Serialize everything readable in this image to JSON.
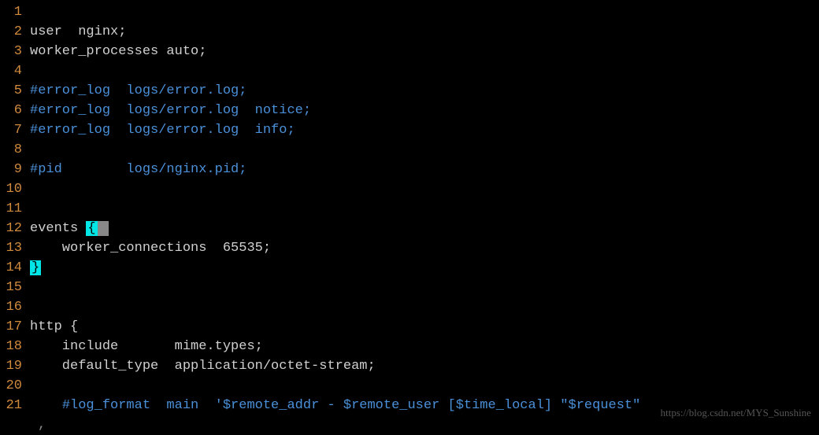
{
  "lines": [
    {
      "num": "1",
      "segments": []
    },
    {
      "num": "2",
      "segments": [
        {
          "cls": "plain",
          "text": "user  nginx;"
        }
      ]
    },
    {
      "num": "3",
      "segments": [
        {
          "cls": "plain",
          "text": "worker_processes auto;"
        }
      ]
    },
    {
      "num": "4",
      "segments": []
    },
    {
      "num": "5",
      "segments": [
        {
          "cls": "comment",
          "text": "#error_log  logs/error.log;"
        }
      ]
    },
    {
      "num": "6",
      "segments": [
        {
          "cls": "comment",
          "text": "#error_log  logs/error.log  notice;"
        }
      ]
    },
    {
      "num": "7",
      "segments": [
        {
          "cls": "comment",
          "text": "#error_log  logs/error.log  info;"
        }
      ]
    },
    {
      "num": "8",
      "segments": []
    },
    {
      "num": "9",
      "segments": [
        {
          "cls": "comment",
          "text": "#pid        logs/nginx.pid;"
        }
      ]
    },
    {
      "num": "10",
      "segments": []
    },
    {
      "num": "11",
      "segments": []
    },
    {
      "num": "12",
      "segments": [
        {
          "cls": "plain",
          "text": "events "
        },
        {
          "cls": "brace",
          "text": "{"
        },
        {
          "cls": "brace-dim",
          "text": " "
        }
      ]
    },
    {
      "num": "13",
      "segments": [
        {
          "cls": "plain",
          "text": "    worker_connections  65535;"
        }
      ]
    },
    {
      "num": "14",
      "segments": [
        {
          "cls": "brace",
          "text": "}"
        }
      ]
    },
    {
      "num": "15",
      "segments": []
    },
    {
      "num": "16",
      "segments": []
    },
    {
      "num": "17",
      "segments": [
        {
          "cls": "plain",
          "text": "http {"
        }
      ]
    },
    {
      "num": "18",
      "segments": [
        {
          "cls": "plain",
          "text": "    include       mime.types;"
        }
      ]
    },
    {
      "num": "19",
      "segments": [
        {
          "cls": "plain",
          "text": "    default_type  application/octet-stream;"
        }
      ]
    },
    {
      "num": "20",
      "segments": []
    },
    {
      "num": "21",
      "segments": [
        {
          "cls": "plain",
          "text": "    "
        },
        {
          "cls": "comment",
          "text": "#log_format  main  '$remote_addr - $remote_user [$time_local] \"$request\""
        }
      ]
    }
  ],
  "continuation": ",",
  "watermark": "https://blog.csdn.net/MYS_Sunshine"
}
